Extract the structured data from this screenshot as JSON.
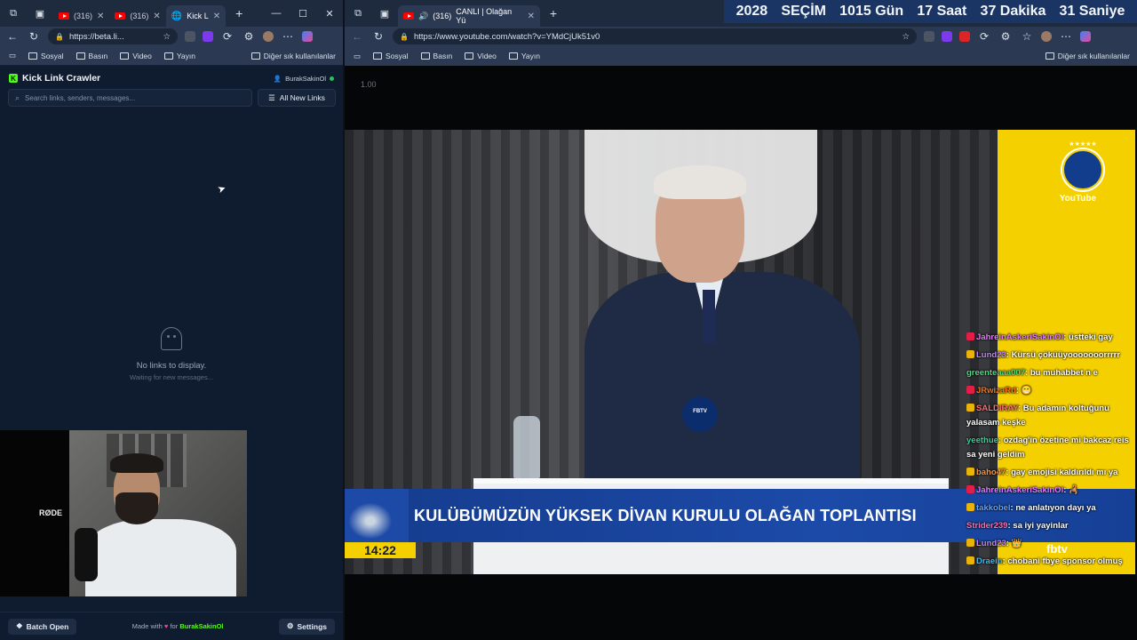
{
  "left_window": {
    "tabs": [
      {
        "label": "(316)",
        "icon": "youtube-icon"
      },
      {
        "label": "(316)",
        "icon": "youtube-icon"
      },
      {
        "label": "Kick L",
        "icon": "globe-icon",
        "active": true
      }
    ],
    "address": "https://beta.li...",
    "bookmarks": [
      "Sosyal",
      "Basın",
      "Video",
      "Yayın"
    ],
    "bookmarks_other": "Diğer sık kullanılanlar"
  },
  "app": {
    "title": "Kick Link Crawler",
    "user": "BurakSakinOl",
    "search_placeholder": "Search links, senders, messages...",
    "filter_label": "All New Links",
    "empty_title": "No links to display.",
    "empty_subtitle": "Waiting for new messages...",
    "footer": {
      "batch_label": "Batch Open",
      "made_prefix": "Made with",
      "made_for": "for",
      "made_name": "BurakSakinOl",
      "settings_label": "Settings"
    }
  },
  "right_window": {
    "tab_count": "(316)",
    "tab_title": "CANLI | Olağan Yü",
    "address": "https://www.youtube.com/watch?v=YMdCjUk51v0",
    "bookmarks": [
      "Sosyal",
      "Basın",
      "Video",
      "Yayın"
    ],
    "bookmarks_other": "Diğer sık kullanılanlar",
    "countdown": [
      "2028",
      "SEÇİM",
      "1015 Gün",
      "17 Saat",
      "37 Dakika",
      "31 Saniye"
    ]
  },
  "video": {
    "speed": "1.00",
    "lower_third": "KULÜBÜMÜZÜN YÜKSEK DİVAN KURULU OLAĞAN TOPLANTISI",
    "time": "14:22",
    "channel_badge": "YouTube",
    "mic_label": "FBTV",
    "watermark": "fbtv"
  },
  "chat": [
    {
      "user": "JahreinAskeriSakinOl",
      "text": "üstteki gay",
      "color": "#e879f9",
      "icon_color": "#e11d48"
    },
    {
      "user": "Lund23",
      "text": "Kürsü çöküüyooooooorrrrr",
      "color": "#c084fc",
      "icon_color": "#eab308"
    },
    {
      "user": "greenteaaa007",
      "text": "bu muhabbet n e",
      "color": "#4ade80",
      "icon_color": ""
    },
    {
      "user": "JRwizaRd",
      "text": "😁",
      "color": "#f97316",
      "icon_color": "#e11d48"
    },
    {
      "user": "SALDIRAY",
      "text": "Bu adamın koltuğunu yalasam keşke",
      "color": "#f87171",
      "icon_color": "#eab308"
    },
    {
      "user": "yeethue",
      "text": "ozdag'in özetine mi bakcaz reis sa yeni geldim",
      "color": "#34d399",
      "icon_color": ""
    },
    {
      "user": "baho47",
      "text": "gay emojisi kaldırıldı mı ya",
      "color": "#fb923c",
      "icon_color": "#eab308"
    },
    {
      "user": "JahreinAskeriSakinOl",
      "text": "🦂",
      "color": "#e879f9",
      "icon_color": "#e11d48"
    },
    {
      "user": "takkobel",
      "text": "ne anlatıyon dayı ya",
      "color": "#60a5fa",
      "icon_color": "#eab308"
    },
    {
      "user": "Strider239",
      "text": "sa iyi yayinlar",
      "color": "#f472b6",
      "icon_color": ""
    },
    {
      "user": "Lund23",
      "text": "👑",
      "color": "#c084fc",
      "icon_color": "#eab308"
    },
    {
      "user": "Draein",
      "text": "chobani fbye sponsor olmuş",
      "color": "#38bdf8",
      "icon_color": "#eab308"
    }
  ]
}
